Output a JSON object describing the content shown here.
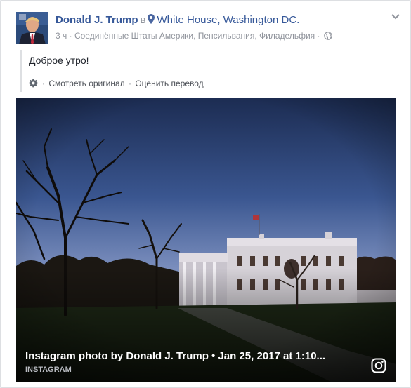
{
  "post": {
    "author": "Donald J. Trump",
    "in_word": "в",
    "location": "White House, Washington DC.",
    "time": "3 ч",
    "dot": "·",
    "place": "Соединённые Штаты Америки, Пенсильвания, Филадельфия",
    "privacy_icon": "globe-icon",
    "text": "Доброе утро!",
    "see_original": "Смотреть оригинал",
    "rate_translation": "Оценить перевод",
    "separator": "·"
  },
  "attachment": {
    "title": "Instagram photo by Donald J. Trump • Jan 25, 2017 at 1:10...",
    "source": "INSTAGRAM",
    "brand_icon": "instagram-icon"
  },
  "colors": {
    "link": "#365899",
    "muted": "#90949c",
    "text": "#1d2129"
  }
}
